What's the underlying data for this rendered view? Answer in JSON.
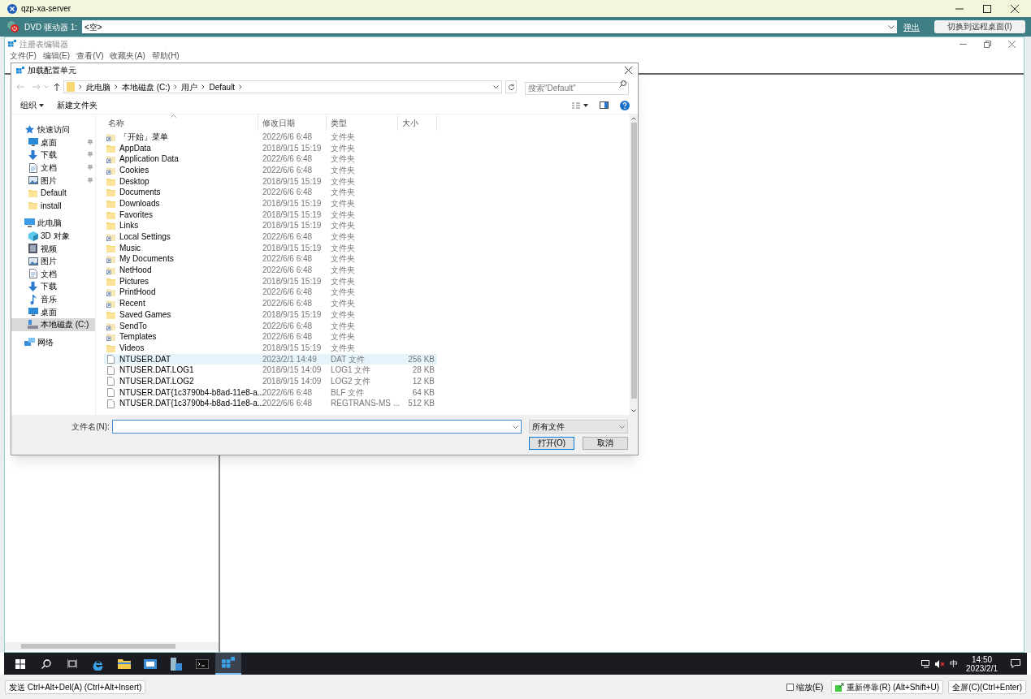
{
  "remote_window": {
    "title": "qzp-xa-server"
  },
  "toolbar": {
    "drive_label": "DVD 驱动器 1:",
    "drive_value": "<空>",
    "eject_link": "弹出",
    "switch_button": "切换到远程桌面(I)"
  },
  "regedit": {
    "title": "注册表编辑器",
    "menu": [
      "文件(F)",
      "编辑(E)",
      "查看(V)",
      "收藏夹(A)",
      "帮助(H)"
    ]
  },
  "dialog": {
    "title": "加载配置单元",
    "breadcrumb": [
      "此电脑",
      "本地磁盘 (C:)",
      "用户",
      "Default"
    ],
    "search_placeholder": "搜索\"Default\"",
    "organize_button": "组织",
    "new_folder_button": "新建文件夹",
    "nav": [
      {
        "label": "快速访问",
        "kind": "star",
        "pinned": false,
        "selected": false,
        "children": [
          {
            "label": "桌面",
            "kind": "desktop",
            "pinned": true,
            "selected": false
          },
          {
            "label": "下载",
            "kind": "download",
            "pinned": true,
            "selected": false
          },
          {
            "label": "文档",
            "kind": "doc",
            "pinned": true,
            "selected": false
          },
          {
            "label": "图片",
            "kind": "picture",
            "pinned": true,
            "selected": false
          },
          {
            "label": "Default",
            "kind": "folder",
            "pinned": false,
            "selected": false
          },
          {
            "label": "install",
            "kind": "folder",
            "pinned": false,
            "selected": false
          }
        ]
      },
      {
        "label": "此电脑",
        "kind": "pc",
        "pinned": false,
        "selected": false,
        "children": [
          {
            "label": "3D 对象",
            "kind": "cube",
            "pinned": false,
            "selected": false
          },
          {
            "label": "视频",
            "kind": "video",
            "pinned": false,
            "selected": false
          },
          {
            "label": "图片",
            "kind": "picture",
            "pinned": false,
            "selected": false
          },
          {
            "label": "文档",
            "kind": "doc",
            "pinned": false,
            "selected": false
          },
          {
            "label": "下载",
            "kind": "download",
            "pinned": false,
            "selected": false
          },
          {
            "label": "音乐",
            "kind": "music",
            "pinned": false,
            "selected": false
          },
          {
            "label": "桌面",
            "kind": "desktop",
            "pinned": false,
            "selected": false
          },
          {
            "label": "本地磁盘 (C:)",
            "kind": "drive",
            "pinned": false,
            "selected": true
          }
        ]
      },
      {
        "label": "网络",
        "kind": "network",
        "pinned": false,
        "selected": false
      }
    ],
    "columns": [
      "名称",
      "修改日期",
      "类型",
      "大小"
    ],
    "files": [
      {
        "name": "「开始」菜单",
        "date": "2022/6/6 6:48",
        "type": "文件夹",
        "kind": "link-folder",
        "highlighted": false
      },
      {
        "name": "AppData",
        "date": "2018/9/15 15:19",
        "type": "文件夹",
        "kind": "folder",
        "highlighted": false
      },
      {
        "name": "Application Data",
        "date": "2022/6/6 6:48",
        "type": "文件夹",
        "kind": "link-folder",
        "highlighted": false
      },
      {
        "name": "Cookies",
        "date": "2022/6/6 6:48",
        "type": "文件夹",
        "kind": "link-folder",
        "highlighted": false
      },
      {
        "name": "Desktop",
        "date": "2018/9/15 15:19",
        "type": "文件夹",
        "kind": "folder",
        "highlighted": false
      },
      {
        "name": "Documents",
        "date": "2022/6/6 6:48",
        "type": "文件夹",
        "kind": "folder",
        "highlighted": false
      },
      {
        "name": "Downloads",
        "date": "2018/9/15 15:19",
        "type": "文件夹",
        "kind": "folder",
        "highlighted": false
      },
      {
        "name": "Favorites",
        "date": "2018/9/15 15:19",
        "type": "文件夹",
        "kind": "folder",
        "highlighted": false
      },
      {
        "name": "Links",
        "date": "2018/9/15 15:19",
        "type": "文件夹",
        "kind": "folder",
        "highlighted": false
      },
      {
        "name": "Local Settings",
        "date": "2022/6/6 6:48",
        "type": "文件夹",
        "kind": "link-folder",
        "highlighted": false
      },
      {
        "name": "Music",
        "date": "2018/9/15 15:19",
        "type": "文件夹",
        "kind": "folder",
        "highlighted": false
      },
      {
        "name": "My Documents",
        "date": "2022/6/6 6:48",
        "type": "文件夹",
        "kind": "link-folder",
        "highlighted": false
      },
      {
        "name": "NetHood",
        "date": "2022/6/6 6:48",
        "type": "文件夹",
        "kind": "link-folder",
        "highlighted": false
      },
      {
        "name": "Pictures",
        "date": "2018/9/15 15:19",
        "type": "文件夹",
        "kind": "folder",
        "highlighted": false
      },
      {
        "name": "PrintHood",
        "date": "2022/6/6 6:48",
        "type": "文件夹",
        "kind": "link-folder",
        "highlighted": false
      },
      {
        "name": "Recent",
        "date": "2022/6/6 6:48",
        "type": "文件夹",
        "kind": "link-folder",
        "highlighted": false
      },
      {
        "name": "Saved Games",
        "date": "2018/9/15 15:19",
        "type": "文件夹",
        "kind": "folder",
        "highlighted": false
      },
      {
        "name": "SendTo",
        "date": "2022/6/6 6:48",
        "type": "文件夹",
        "kind": "link-folder",
        "highlighted": false
      },
      {
        "name": "Templates",
        "date": "2022/6/6 6:48",
        "type": "文件夹",
        "kind": "link-folder",
        "highlighted": false
      },
      {
        "name": "Videos",
        "date": "2018/9/15 15:19",
        "type": "文件夹",
        "kind": "folder",
        "highlighted": false
      },
      {
        "name": "NTUSER.DAT",
        "date": "2023/2/1 14:49",
        "type": "DAT 文件",
        "size": "256 KB",
        "kind": "file",
        "highlighted": true
      },
      {
        "name": "NTUSER.DAT.LOG1",
        "date": "2018/9/15 14:09",
        "type": "LOG1 文件",
        "size": "28 KB",
        "kind": "file",
        "highlighted": false
      },
      {
        "name": "NTUSER.DAT.LOG2",
        "date": "2018/9/15 14:09",
        "type": "LOG2 文件",
        "size": "12 KB",
        "kind": "file",
        "highlighted": false
      },
      {
        "name": "NTUSER.DAT{1c3790b4-b8ad-11e8-a...",
        "date": "2022/6/6 6:48",
        "type": "BLF 文件",
        "size": "64 KB",
        "kind": "file",
        "highlighted": false
      },
      {
        "name": "NTUSER.DAT{1c3790b4-b8ad-11e8-a...",
        "date": "2022/6/6 6:48",
        "type": "REGTRANS-MS ...",
        "size": "512 KB",
        "kind": "file",
        "highlighted": false
      }
    ],
    "filename_label": "文件名(N):",
    "filter": "所有文件",
    "open_button": "打开(O)",
    "cancel_button": "取消"
  },
  "taskbar": {
    "apps": [
      {
        "kind": "start",
        "active": false
      },
      {
        "kind": "search",
        "active": false
      },
      {
        "kind": "taskview",
        "active": false
      },
      {
        "kind": "browser",
        "active": false
      },
      {
        "kind": "explorer",
        "active": false
      },
      {
        "kind": "window",
        "active": false
      },
      {
        "kind": "server",
        "active": false
      },
      {
        "kind": "terminal",
        "active": false
      },
      {
        "kind": "registry",
        "active": true
      }
    ],
    "ime": "中",
    "time": "14:50",
    "date": "2023/2/1"
  },
  "bottom_bar": {
    "cad_button": "发送 Ctrl+Alt+Del(A) (Ctrl+Alt+Insert)",
    "zoom_checkbox": {
      "label": "缩放(E)",
      "checked": false
    },
    "redock_button": "重新停靠(R) (Alt+Shift+U)",
    "fullscreen_button": "全屏(C)(Ctrl+Enter)"
  }
}
